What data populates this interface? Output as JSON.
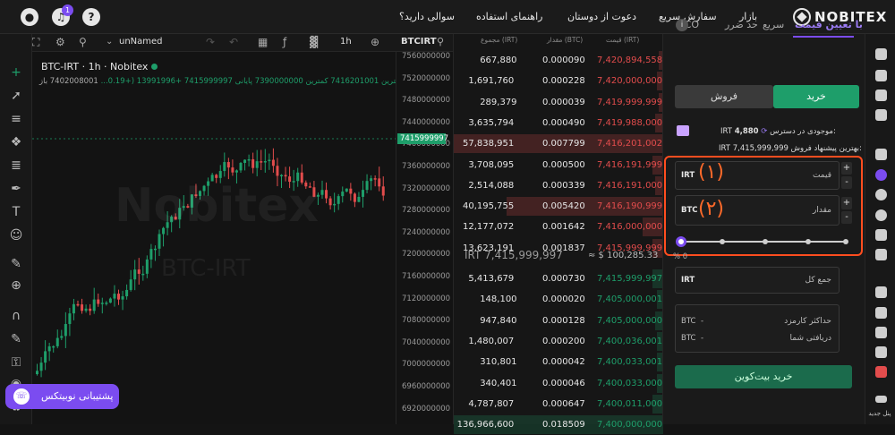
{
  "header": {
    "brand": "NOBITEX",
    "notification_count": "1",
    "nav": [
      "بازار",
      "سفارش سریع",
      "دعوت از دوستان",
      "راهنمای استفاده",
      "سوالی دارید؟"
    ]
  },
  "chart_toolbar": {
    "layout_name": "unNamed",
    "interval": "1h",
    "symbol": "BTCIRT"
  },
  "chart_legend": {
    "title": "BTC-IRT · 1h · Nobitex",
    "ohlc": "بیشترین 7416201001 کمترین 7390000000 پایانی 7415999997 +13991996 (+0.19...",
    "open_label": "7402008001 باز"
  },
  "watermark": {
    "line1": "Nobitex",
    "line2": "BTC-IRT"
  },
  "yaxis": {
    "ticks": [
      "7560000000",
      "7520000000",
      "7480000000",
      "7440000000",
      "7400000000",
      "7360000000",
      "7320000000",
      "7280000000",
      "7240000000",
      "7200000000",
      "7160000000",
      "7120000000",
      "7080000000",
      "7040000000",
      "7000000000",
      "6960000000",
      "6920000000"
    ],
    "current": "7415999997"
  },
  "support_button": "پشتیبانی نوبیتکس",
  "orderbook": {
    "headers": {
      "total": "مجموع (IRT)",
      "amount": "مقدار (BTC)",
      "price": "قیمت (IRT)"
    },
    "asks": [
      {
        "total": "667,880",
        "amount": "0.000090",
        "price": "7,420,894,558",
        "depth": 0.02
      },
      {
        "total": "1,691,760",
        "amount": "0.000228",
        "price": "7,420,000,000",
        "depth": 0.03
      },
      {
        "total": "289,379",
        "amount": "0.000039",
        "price": "7,419,999,999",
        "depth": 0.02
      },
      {
        "total": "3,635,794",
        "amount": "0.000490",
        "price": "7,419,988,000",
        "depth": 0.04
      },
      {
        "total": "57,838,951",
        "amount": "0.007799",
        "price": "7,416,201,002",
        "depth": 1.0
      },
      {
        "total": "3,708,095",
        "amount": "0.000500",
        "price": "7,416,191,999",
        "depth": 0.05
      },
      {
        "total": "2,514,088",
        "amount": "0.000339",
        "price": "7,416,191,000",
        "depth": 0.04
      },
      {
        "total": "40,195,755",
        "amount": "0.005420",
        "price": "7,416,190,999",
        "depth": 0.75
      },
      {
        "total": "12,177,072",
        "amount": "0.001642",
        "price": "7,416,000,000",
        "depth": 0.1
      },
      {
        "total": "13,623,191",
        "amount": "0.001837",
        "price": "7,415,999,999",
        "depth": 0.05
      }
    ],
    "last_price": "IRT 7,415,999,997",
    "last_usd": "≈ $ 100,285.33",
    "bids": [
      {
        "total": "5,413,679",
        "amount": "0.000730",
        "price": "7,415,999,997",
        "depth": 0.05
      },
      {
        "total": "148,100",
        "amount": "0.000020",
        "price": "7,405,000,001",
        "depth": 0.03
      },
      {
        "total": "947,840",
        "amount": "0.000128",
        "price": "7,405,000,000",
        "depth": 0.04
      },
      {
        "total": "1,480,007",
        "amount": "0.000200",
        "price": "7,400,036,001",
        "depth": 0.03
      },
      {
        "total": "310,801",
        "amount": "0.000042",
        "price": "7,400,033,001",
        "depth": 0.03
      },
      {
        "total": "340,401",
        "amount": "0.000046",
        "price": "7,400,033,000",
        "depth": 0.03
      },
      {
        "total": "4,787,807",
        "amount": "0.000647",
        "price": "7,400,011,000",
        "depth": 0.05
      },
      {
        "total": "136,966,600",
        "amount": "0.018509",
        "price": "7,400,000,000",
        "depth": 1.0
      }
    ]
  },
  "trade": {
    "tabs": [
      "با تعیین قیمت",
      "سریع",
      "حد ضرر",
      "OCO"
    ],
    "buy_label": "خرید",
    "sell_label": "فروش",
    "available_label": "موجودی در دسترس:",
    "available_value": "4,880",
    "available_unit": "IRT",
    "best_offer_label": "بهترین پیشنهاد فروش:",
    "best_offer_value": "7,415,999,999",
    "best_offer_unit": "IRT",
    "price_label": "قیمت",
    "price_unit": "IRT",
    "amount_label": "مقدار",
    "amount_unit": "BTC",
    "annotation_1": "(۱)",
    "annotation_2": "(۲)",
    "percent": "0 %",
    "slider_value": 0,
    "total_label": "جمع کل",
    "total_unit": "IRT",
    "fee_label": "حداکثر کارمزد",
    "fee_unit": "BTC",
    "fee_value": "-",
    "receive_label": "دریافتی شما",
    "receive_unit": "BTC",
    "receive_value": "-",
    "submit_label": "خرید بیت‌کوین"
  },
  "right_panel": {
    "new_panel_label": "پنل جدید"
  },
  "colors": {
    "green": "#1e9e6a",
    "red": "#e24c4c",
    "accent": "#7b4cf0",
    "annotation": "#ff4d1f"
  }
}
